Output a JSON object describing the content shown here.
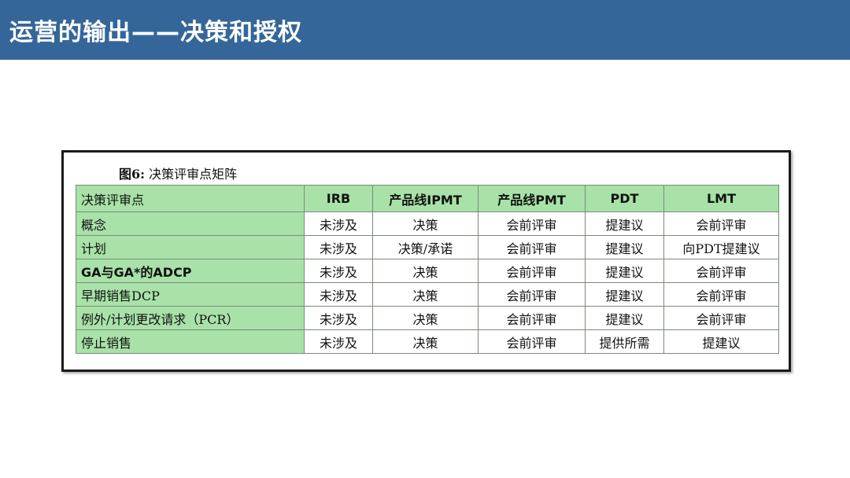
{
  "slide_title": "运营的输出——决策和授权",
  "figure": {
    "caption_prefix": "图6:",
    "caption_text": "决策评审点矩阵"
  },
  "table": {
    "headers": [
      "决策评审点",
      "IRB",
      "产品线IPMT",
      "产品线PMT",
      "PDT",
      "LMT"
    ],
    "rows": [
      [
        "概念",
        "未涉及",
        "决策",
        "会前评审",
        "提建议",
        "会前评审"
      ],
      [
        "计划",
        "未涉及",
        "决策/承诺",
        "会前评审",
        "提建议",
        "向PDT提建议"
      ],
      [
        "GA与GA*的ADCP",
        "未涉及",
        "决策",
        "会前评审",
        "提建议",
        "会前评审"
      ],
      [
        "早期销售DCP",
        "未涉及",
        "决策",
        "会前评审",
        "提建议",
        "会前评审"
      ],
      [
        "例外/计划更改请求（PCR）",
        "未涉及",
        "决策",
        "会前评审",
        "提建议",
        "会前评审"
      ],
      [
        "停止销售",
        "未涉及",
        "决策",
        "会前评审",
        "提供所需",
        "提建议"
      ]
    ]
  }
}
